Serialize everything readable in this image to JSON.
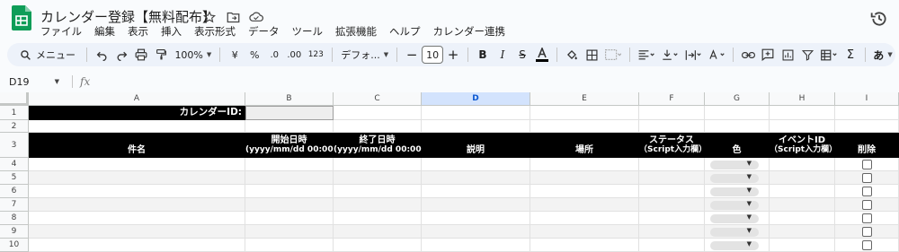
{
  "app": {
    "title": "カレンダー登録【無料配布】",
    "title_icons": [
      "star-icon",
      "move-to-folder-icon",
      "cloud-saved-icon"
    ],
    "history_icon": "history-icon"
  },
  "menu": [
    "ファイル",
    "編集",
    "表示",
    "挿入",
    "表示形式",
    "データ",
    "ツール",
    "拡張機能",
    "ヘルプ",
    "カレンダー連携"
  ],
  "toolbar": {
    "search_label": "メニュー",
    "zoom": "100%",
    "currency": "¥",
    "percent": "%",
    "dec_decrease": ".0",
    "dec_increase": ".00",
    "number_format": "123",
    "font": "デフォ...",
    "font_size": "10"
  },
  "formula_bar": {
    "name_box": "D19",
    "fx": "fx",
    "value": ""
  },
  "sheet": {
    "columns": [
      "A",
      "B",
      "C",
      "D",
      "E",
      "F",
      "G",
      "H",
      "I"
    ],
    "selected_column": "D",
    "rows": [
      "1",
      "2",
      "3",
      "4",
      "5",
      "6",
      "7",
      "8",
      "9",
      "10"
    ],
    "calendar_id_label": "カレンダーID:",
    "calendar_id_value": "",
    "headers": {
      "name": "件名",
      "start_1": "開始日時",
      "start_2": "(yyyy/mm/dd 00:00)",
      "end_1": "終了日時",
      "end_2": "(yyyy/mm/dd 00:00)",
      "description": "説明",
      "location": "場所",
      "status_1": "ステータス",
      "status_2": "（Script入力欄）",
      "color": "色",
      "event_id_1": "イベントID",
      "event_id_2": "（Script入力欄）",
      "delete": "削除"
    },
    "data_rows": [
      {
        "row": "4",
        "color": "",
        "delete": false
      },
      {
        "row": "5",
        "color": "",
        "delete": false
      },
      {
        "row": "6",
        "color": "",
        "delete": false
      },
      {
        "row": "7",
        "color": "",
        "delete": false
      },
      {
        "row": "8",
        "color": "",
        "delete": false
      },
      {
        "row": "9",
        "color": "",
        "delete": false
      },
      {
        "row": "10",
        "color": "",
        "delete": false
      }
    ]
  },
  "colors": {
    "header_bg": "#000000",
    "header_text": "#ffffff",
    "sheets_green": "#0f9d58",
    "selection_blue": "#d3e3fd",
    "toolbar_bg": "#edf2fa"
  }
}
